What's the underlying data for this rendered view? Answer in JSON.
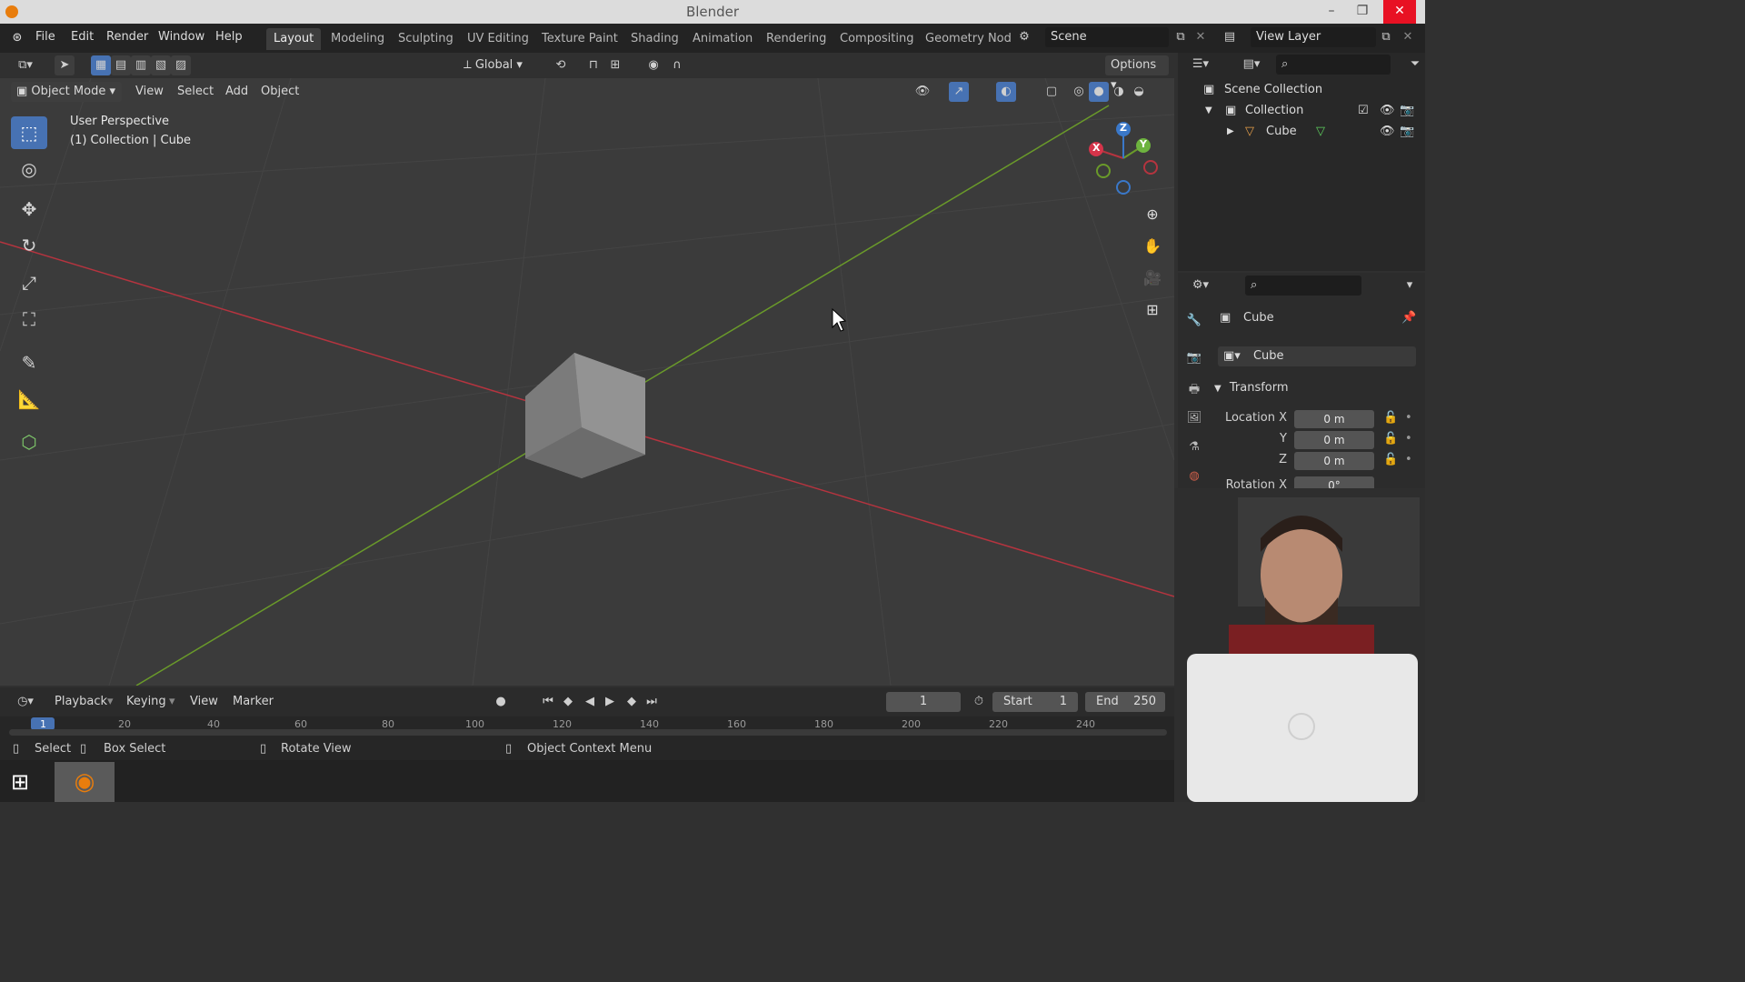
{
  "window": {
    "title": "Blender",
    "minimize": "–",
    "maximize": "❐",
    "close": "✕"
  },
  "menus": [
    "File",
    "Edit",
    "Render",
    "Window",
    "Help"
  ],
  "workspaces": [
    "Layout",
    "Modeling",
    "Sculpting",
    "UV Editing",
    "Texture Paint",
    "Shading",
    "Animation",
    "Rendering",
    "Compositing",
    "Geometry Nod"
  ],
  "scene": {
    "name": "Scene",
    "view_layer": "View Layer"
  },
  "tool_header": {
    "transform_orientation": "Global",
    "options": "Options"
  },
  "viewport_header": {
    "mode": "Object Mode",
    "menus": [
      "View",
      "Select",
      "Add",
      "Object"
    ]
  },
  "viewport": {
    "perspective": "User Perspective",
    "context": "(1) Collection | Cube"
  },
  "gizmo": {
    "x": "X",
    "y": "Y",
    "z": "Z"
  },
  "outliner": {
    "scene_collection": "Scene Collection",
    "collection": "Collection",
    "object": "Cube"
  },
  "properties": {
    "object_name": "Cube",
    "data_name": "Cube",
    "panel": "Transform",
    "location_x_label": "Location X",
    "y_label": "Y",
    "z_label": "Z",
    "rotation_x_label": "Rotation X",
    "location_x": "0 m",
    "location_y": "0 m",
    "location_z": "0 m",
    "rotation_x": "0°"
  },
  "timeline": {
    "menus": [
      "Playback",
      "Keying",
      "View",
      "Marker"
    ],
    "current_frame": "1",
    "start_label": "Start",
    "start": "1",
    "end_label": "End",
    "end": "250",
    "ticks": [
      "1",
      "20",
      "40",
      "60",
      "80",
      "100",
      "120",
      "140",
      "160",
      "180",
      "200",
      "220",
      "240"
    ]
  },
  "status": {
    "select": "Select",
    "box_select": "Box Select",
    "rotate_view": "Rotate View",
    "context_menu": "Object Context Menu"
  },
  "colors": {
    "accent": "#4772b3",
    "x_axis": "#b5343f",
    "y_axis": "#6a9a2a",
    "z_axis": "#3a78c9"
  }
}
